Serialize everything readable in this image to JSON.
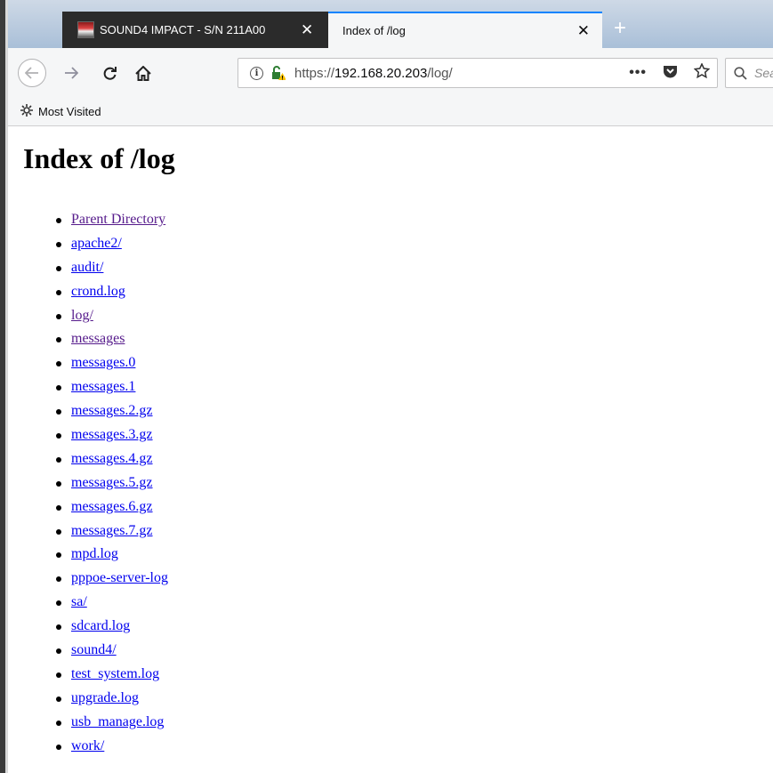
{
  "tabs": [
    {
      "title": "SOUND4 IMPACT - S/N 211A00",
      "active": false,
      "close": "✕"
    },
    {
      "title": "Index of /log",
      "active": true,
      "close": "✕"
    }
  ],
  "new_tab_label": "+",
  "nav": {
    "url_prefix": "https://",
    "url_host": "192.168.20.203",
    "url_path": "/log/",
    "search_placeholder": "Sea"
  },
  "bookmarks": {
    "most_visited": "Most Visited"
  },
  "page": {
    "heading": "Index of /log",
    "entries": [
      {
        "name": "Parent Directory",
        "visited": true
      },
      {
        "name": "apache2/",
        "visited": false
      },
      {
        "name": "audit/",
        "visited": false
      },
      {
        "name": "crond.log",
        "visited": false
      },
      {
        "name": "log/",
        "visited": true
      },
      {
        "name": "messages",
        "visited": true
      },
      {
        "name": "messages.0",
        "visited": false
      },
      {
        "name": "messages.1",
        "visited": false
      },
      {
        "name": "messages.2.gz",
        "visited": false
      },
      {
        "name": "messages.3.gz",
        "visited": false
      },
      {
        "name": "messages.4.gz",
        "visited": false
      },
      {
        "name": "messages.5.gz",
        "visited": false
      },
      {
        "name": "messages.6.gz",
        "visited": false
      },
      {
        "name": "messages.7.gz",
        "visited": false
      },
      {
        "name": "mpd.log",
        "visited": false
      },
      {
        "name": "pppoe-server-log",
        "visited": false
      },
      {
        "name": "sa/",
        "visited": false
      },
      {
        "name": "sdcard.log",
        "visited": false
      },
      {
        "name": "sound4/",
        "visited": false
      },
      {
        "name": "test_system.log",
        "visited": false
      },
      {
        "name": "upgrade.log",
        "visited": false
      },
      {
        "name": "usb_manage.log",
        "visited": false
      },
      {
        "name": "work/",
        "visited": false
      }
    ]
  },
  "colors": {
    "link": "#0000ee",
    "visited": "#551a8b",
    "accent": "#0a84ff"
  }
}
